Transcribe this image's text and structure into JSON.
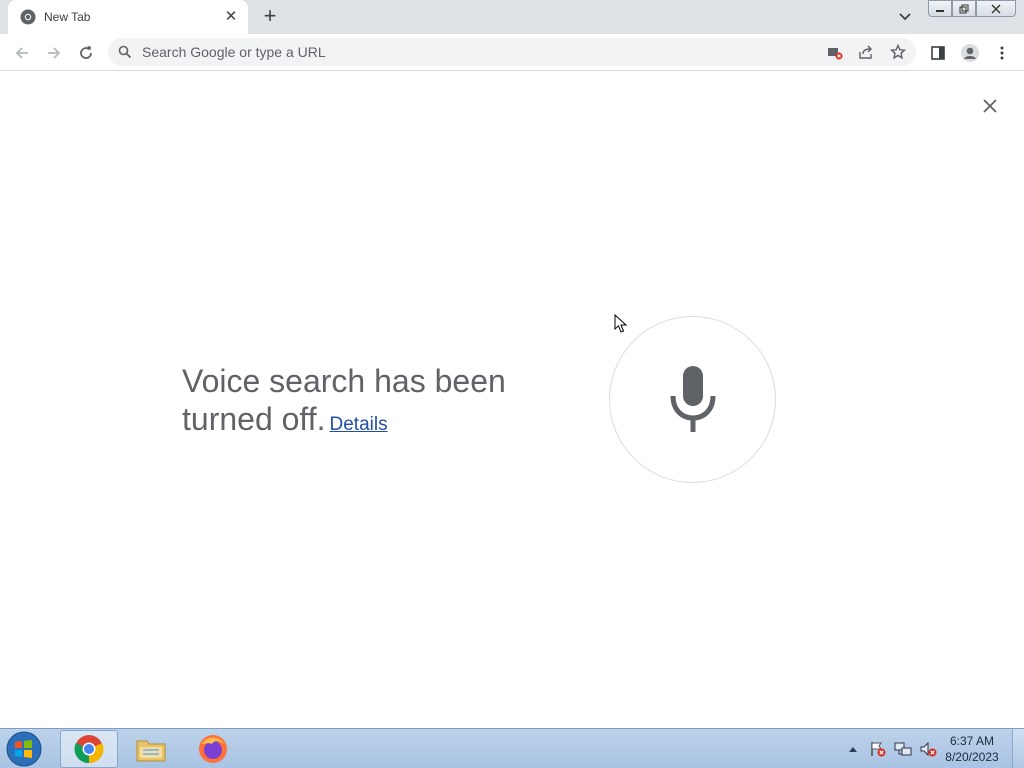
{
  "browser": {
    "tab": {
      "title": "New Tab",
      "favicon": "chrome-icon"
    },
    "omnibox": {
      "placeholder": "Search Google or type a URL"
    }
  },
  "voice_overlay": {
    "message": "Voice search has been turned off.",
    "details_link": "Details"
  },
  "taskbar": {
    "apps": [
      "chrome",
      "file-explorer",
      "firefox"
    ],
    "clock": {
      "time": "6:37 AM",
      "date": "8/20/2023"
    }
  },
  "colors": {
    "tabstrip": "#dee1e6",
    "taskbar": "#b3cbe6",
    "text": "#5f6368",
    "link": "#1f4fa8"
  }
}
